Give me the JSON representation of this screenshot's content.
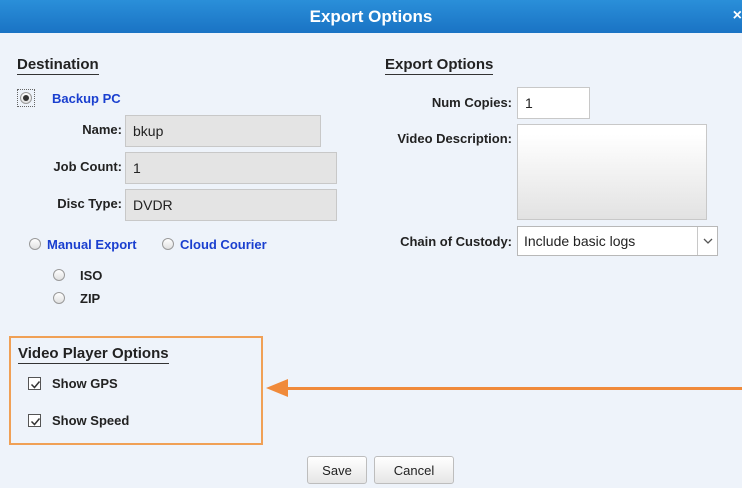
{
  "dialog": {
    "title": "Export Options",
    "close_label": "×"
  },
  "destination": {
    "heading": "Destination",
    "backup_pc": {
      "label": "Backup PC",
      "selected": true
    },
    "name": {
      "label": "Name:",
      "value": "bkup"
    },
    "job_count": {
      "label": "Job Count:",
      "value": "1"
    },
    "disc_type": {
      "label": "Disc Type:",
      "value": "DVDR"
    },
    "manual_export": {
      "label": "Manual Export",
      "selected": false
    },
    "cloud_courier": {
      "label": "Cloud Courier",
      "selected": false
    },
    "formats": [
      {
        "label": "ISO",
        "selected": false
      },
      {
        "label": "ZIP",
        "selected": false
      }
    ]
  },
  "export_options": {
    "heading": "Export Options",
    "num_copies": {
      "label": "Num Copies:",
      "value": "1"
    },
    "video_description": {
      "label": "Video Description:",
      "value": ""
    },
    "chain_of_custody": {
      "label": "Chain of Custody:",
      "value": "Include basic logs"
    }
  },
  "video_player_options": {
    "heading": "Video Player Options",
    "show_gps": {
      "label": "Show GPS",
      "checked": true
    },
    "show_speed": {
      "label": "Show Speed",
      "checked": true
    }
  },
  "footer": {
    "save_label": "Save",
    "cancel_label": "Cancel"
  },
  "colors": {
    "titlebar": "#1a73c4",
    "background": "#eef3fa",
    "link": "#1a3fcf",
    "highlight": "#f08a3a"
  }
}
